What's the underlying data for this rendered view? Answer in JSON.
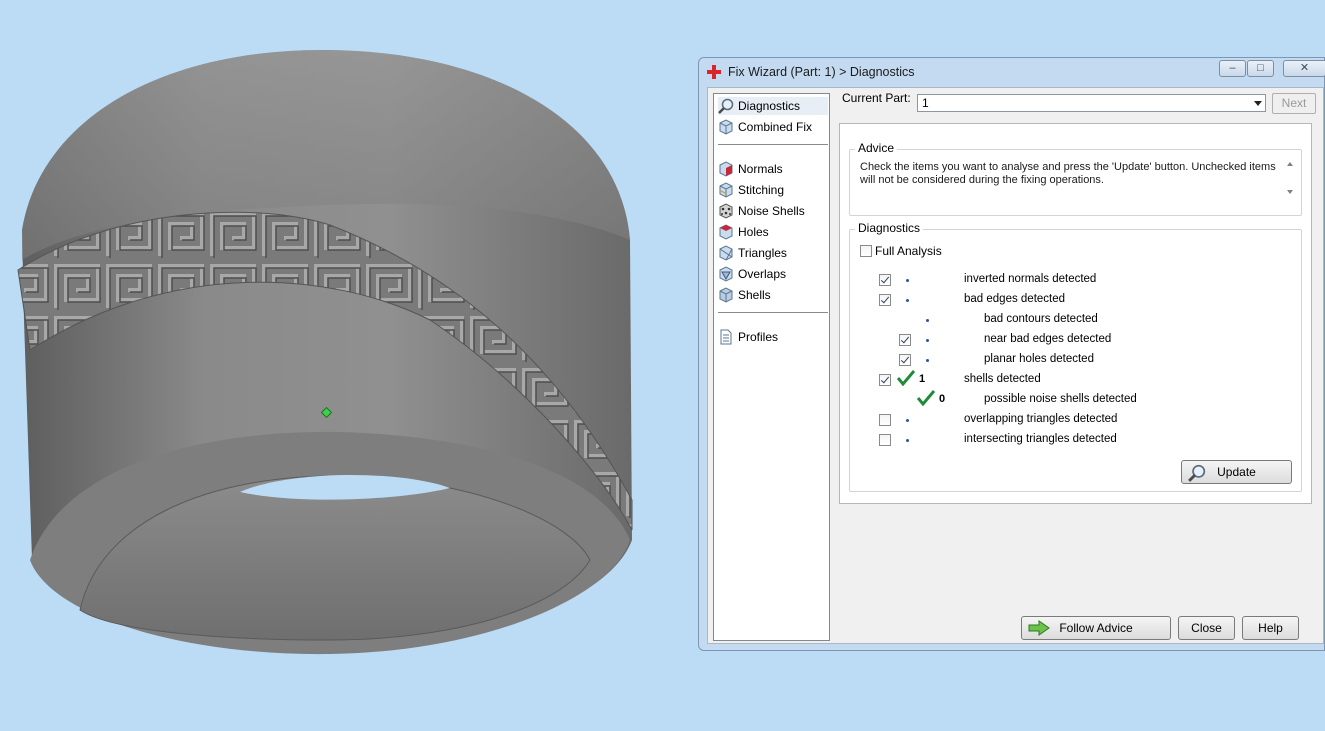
{
  "window": {
    "title": "Fix Wizard (Part: 1) > Diagnostics",
    "icons": {
      "app": "red-cross-icon",
      "minimize": "minimize-icon",
      "maximize": "maximize-icon",
      "close": "close-icon"
    }
  },
  "nav": {
    "top": [
      {
        "label": "Diagnostics",
        "icon": "magnifier-icon",
        "selected": true
      },
      {
        "label": "Combined Fix",
        "icon": "cube-icon"
      }
    ],
    "fixes": [
      {
        "label": "Normals",
        "icon": "normals-cube-icon"
      },
      {
        "label": "Stitching",
        "icon": "stitching-cube-icon"
      },
      {
        "label": "Noise Shells",
        "icon": "noise-shells-icon"
      },
      {
        "label": "Holes",
        "icon": "holes-cube-icon"
      },
      {
        "label": "Triangles",
        "icon": "triangles-cube-icon"
      },
      {
        "label": "Overlaps",
        "icon": "overlaps-cube-icon"
      },
      {
        "label": "Shells",
        "icon": "shells-cube-icon"
      }
    ],
    "bottom": [
      {
        "label": "Profiles",
        "icon": "document-icon"
      }
    ]
  },
  "current_part": {
    "label": "Current Part:",
    "value": "1",
    "next_label": "Next"
  },
  "advice": {
    "title": "Advice",
    "text": "Check the items you want to analyse and press the 'Update' button. Unchecked items will not be considered during the fixing operations."
  },
  "diagnostics": {
    "title": "Diagnostics",
    "full_analysis_label": "Full Analysis",
    "full_analysis_checked": false,
    "rows": [
      {
        "label": "inverted normals detected",
        "checked": true,
        "indent": 0,
        "status": "dot",
        "count": ""
      },
      {
        "label": "bad edges detected",
        "checked": true,
        "indent": 0,
        "status": "dot",
        "count": ""
      },
      {
        "label": "bad contours detected",
        "checked": null,
        "indent": 1,
        "status": "dot",
        "count": ""
      },
      {
        "label": "near bad edges detected",
        "checked": true,
        "indent": 1,
        "status": "dot",
        "count": ""
      },
      {
        "label": "planar holes detected",
        "checked": true,
        "indent": 1,
        "status": "dot",
        "count": ""
      },
      {
        "label": "shells detected",
        "checked": true,
        "indent": 0,
        "status": "ok",
        "count": "1"
      },
      {
        "label": "possible noise shells detected",
        "checked": null,
        "indent": 1,
        "status": "ok",
        "count": "0"
      },
      {
        "label": "overlapping triangles detected",
        "checked": false,
        "indent": 0,
        "status": "dot",
        "count": ""
      },
      {
        "label": "intersecting triangles detected",
        "checked": false,
        "indent": 0,
        "status": "dot",
        "count": ""
      }
    ],
    "update_label": "Update",
    "update_icon": "magnifier-icon"
  },
  "footer": {
    "follow_advice_label": "Follow Advice",
    "follow_advice_icon": "green-arrow-icon",
    "close_label": "Close",
    "help_label": "Help"
  },
  "colors": {
    "background": "#bcdcf6",
    "model": "#8a8a8a",
    "check_green": "#1f8a3a",
    "dot_blue": "#2e52a8"
  }
}
